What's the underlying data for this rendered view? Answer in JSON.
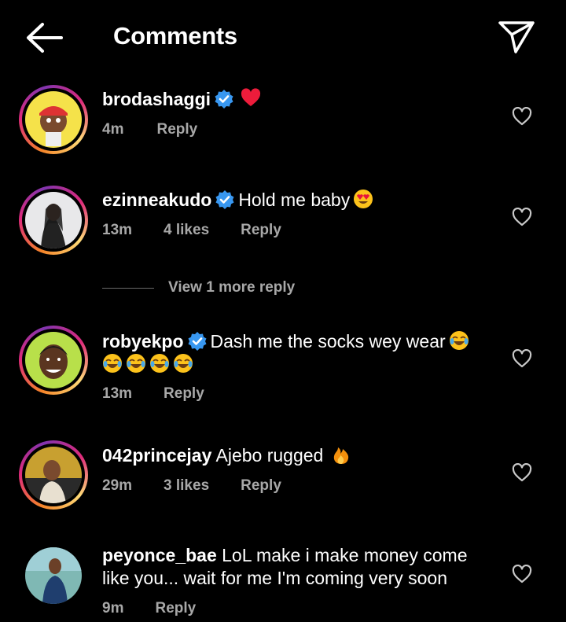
{
  "header": {
    "title": "Comments",
    "back_icon": "arrow-left-icon",
    "share_icon": "paper-plane-icon"
  },
  "comments": [
    {
      "username": "brodashaggi",
      "verified": true,
      "text": "",
      "emojis": [
        "red-heart"
      ],
      "time": "4m",
      "likes": "",
      "reply": "Reply"
    },
    {
      "username": "ezinneakudo",
      "verified": true,
      "text": "Hold me baby",
      "emojis": [
        "heart-eyes"
      ],
      "time": "13m",
      "likes": "4 likes",
      "reply": "Reply"
    },
    {
      "username": "robyekpo",
      "verified": true,
      "text": "Dash me the socks wey wear",
      "emojis": [
        "joy",
        "joy",
        "joy",
        "joy",
        "joy"
      ],
      "time": "13m",
      "likes": "",
      "reply": "Reply"
    },
    {
      "username": "042princejay",
      "verified": false,
      "text": "Ajebo rugged",
      "emojis": [
        "fire"
      ],
      "time": "29m",
      "likes": "3 likes",
      "reply": "Reply"
    },
    {
      "username": "peyonce_bae",
      "verified": false,
      "text": "LoL make i make money come like you... wait for me I'm coming very soon",
      "emojis": [],
      "time": "9m",
      "likes": "",
      "reply": "Reply"
    }
  ],
  "view_more_replies": "View 1 more reply",
  "colors": {
    "background": "#000000",
    "meta": "#a8a8a8",
    "verified": "#3897f0",
    "heart": "#ed1c3b"
  }
}
